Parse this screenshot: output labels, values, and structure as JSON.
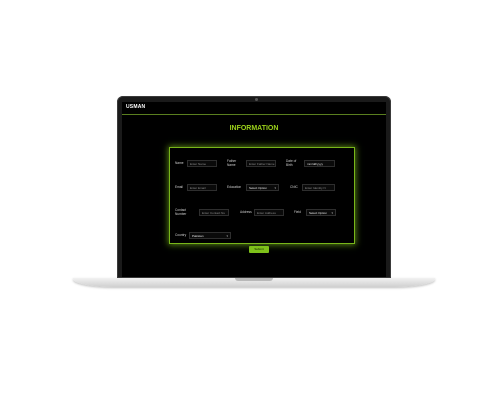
{
  "app": {
    "brand": "USMAN",
    "title": "INFORMATION"
  },
  "form": {
    "row1": {
      "name_label": "Name",
      "name_placeholder": "Enter Name",
      "father_label_1": "Father",
      "father_label_2": "Name",
      "father_placeholder": "Enter Father Name",
      "dob_label_1": "Date of",
      "dob_label_2": "Birth",
      "dob_placeholder": "mm/dd/yyyy"
    },
    "row2": {
      "email_label": "Email",
      "email_placeholder": "Enter Email",
      "education_label": "Education",
      "education_value": "Select Option",
      "cnic_label": "CNIC",
      "cnic_placeholder": "Enter Identity N"
    },
    "row3": {
      "contact_label_1": "Contact",
      "contact_label_2": "Number",
      "contact_placeholder": "Enter Contact Nu",
      "address_label": "Address",
      "address_placeholder": "Enter Address",
      "field_label": "Field",
      "field_value": "Select Option"
    },
    "row4": {
      "country_label": "Country",
      "country_value": "Pakistan"
    },
    "submit_label": "Submit"
  },
  "colors": {
    "accent": "#7ec11a",
    "title": "#9bd11a",
    "background": "#000000"
  }
}
